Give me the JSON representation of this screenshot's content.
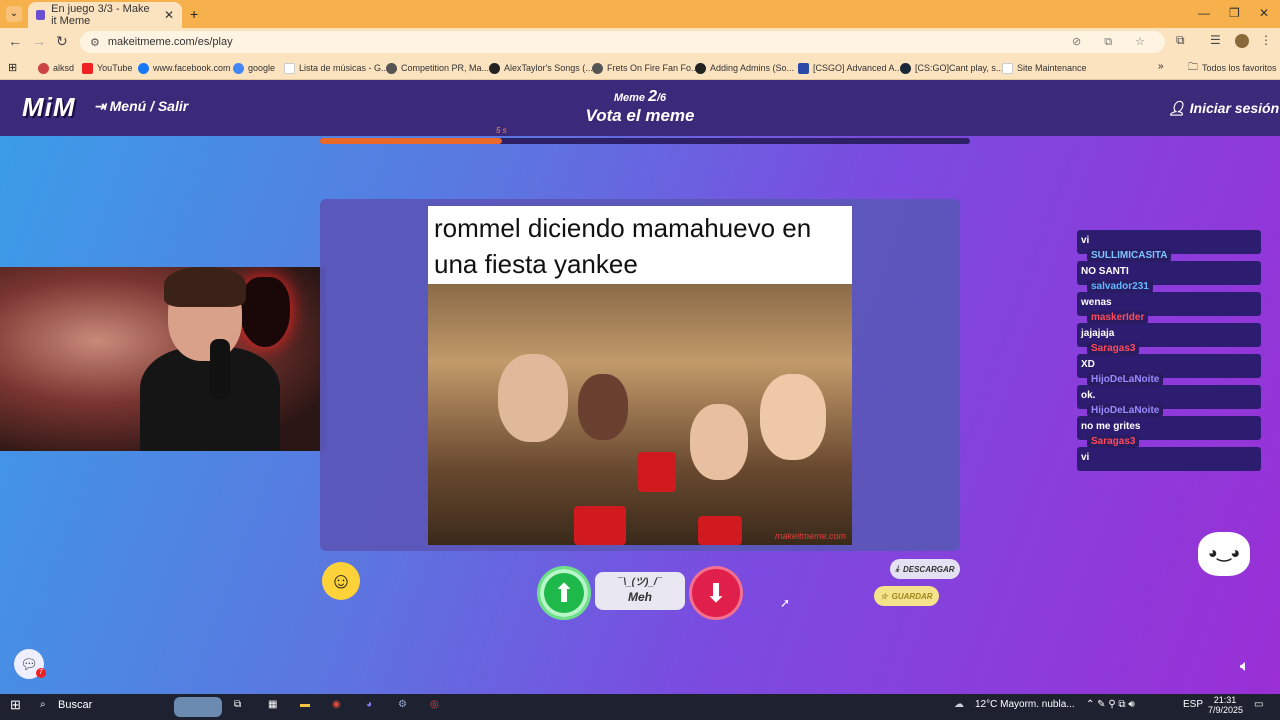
{
  "browser": {
    "tab_title": "En juego 3/3 - Make it Meme",
    "url": "makeitmeme.com/es/play",
    "bookmarks": [
      {
        "label": "alksd",
        "icon": "gmail-icon"
      },
      {
        "label": "YouTube",
        "icon": "youtube-icon"
      },
      {
        "label": "www.facebook.com",
        "icon": "facebook-icon"
      },
      {
        "label": "google",
        "icon": "google-icon"
      },
      {
        "label": "Lista de músicas - G...",
        "icon": "doc-icon"
      },
      {
        "label": "Competition PR, Ma...",
        "icon": "site-icon"
      },
      {
        "label": "AlexTaylor's Songs (...",
        "icon": "github-icon"
      },
      {
        "label": "Frets On Fire Fan Fo...",
        "icon": "site-icon"
      },
      {
        "label": "Adding Admins (So...",
        "icon": "github-icon"
      },
      {
        "label": "[CSGO] Advanced A...",
        "icon": "site-icon"
      },
      {
        "label": "[CS:GO]Cant play, s...",
        "icon": "steam-icon"
      },
      {
        "label": "Site Maintenance",
        "icon": "doc-icon"
      }
    ],
    "all_bookmarks": "Todos los favoritos"
  },
  "header": {
    "logo": "MiM",
    "menu_label": "Menú / Salir",
    "meme_prefix": "Meme",
    "meme_current": "2",
    "meme_total": "/6",
    "subtitle": "Vota el meme",
    "login_label": "Iniciar sesión"
  },
  "timer": {
    "label": "5 s",
    "progress": 0.28
  },
  "meme": {
    "caption": "rommel diciendo mamahuevo en una fiesta yankee",
    "watermark": "makeitmeme.com"
  },
  "chat": [
    {
      "user": "",
      "text": "vi",
      "color": "#ffffff"
    },
    {
      "user": "SULLIMICASITA",
      "text": "NO SANTI",
      "color": "#7cc4ff"
    },
    {
      "user": "salvador231",
      "text": "wenas",
      "color": "#60b8ff"
    },
    {
      "user": "maskerIder",
      "text": "jajajaja",
      "color": "#ff4a5a"
    },
    {
      "user": "Saragas3",
      "text": "XD",
      "color": "#ff4a5a"
    },
    {
      "user": "HijoDeLaNoite",
      "text": "ok.",
      "color": "#9a8aff"
    },
    {
      "user": "HijoDeLaNoite",
      "text": "no me grites",
      "color": "#9a8aff"
    },
    {
      "user": "Saragas3",
      "text": "vi",
      "color": "#ff4a5a"
    }
  ],
  "vote": {
    "meh_face": "¯\\_(ツ)_/¯",
    "meh_label": "Meh"
  },
  "actions": {
    "download": "DESCARGAR",
    "save": "GUARDAR"
  },
  "taskbar": {
    "search": "Buscar",
    "weather": "12°C  Mayorm. nubla...",
    "lang": "ESP",
    "time": "21:31",
    "date": "7/9/2025"
  },
  "colors": {
    "header_bg": "#3b2a7a",
    "upvote": "#1fb84a",
    "downvote": "#e0204a",
    "timer": "#e9682a"
  }
}
